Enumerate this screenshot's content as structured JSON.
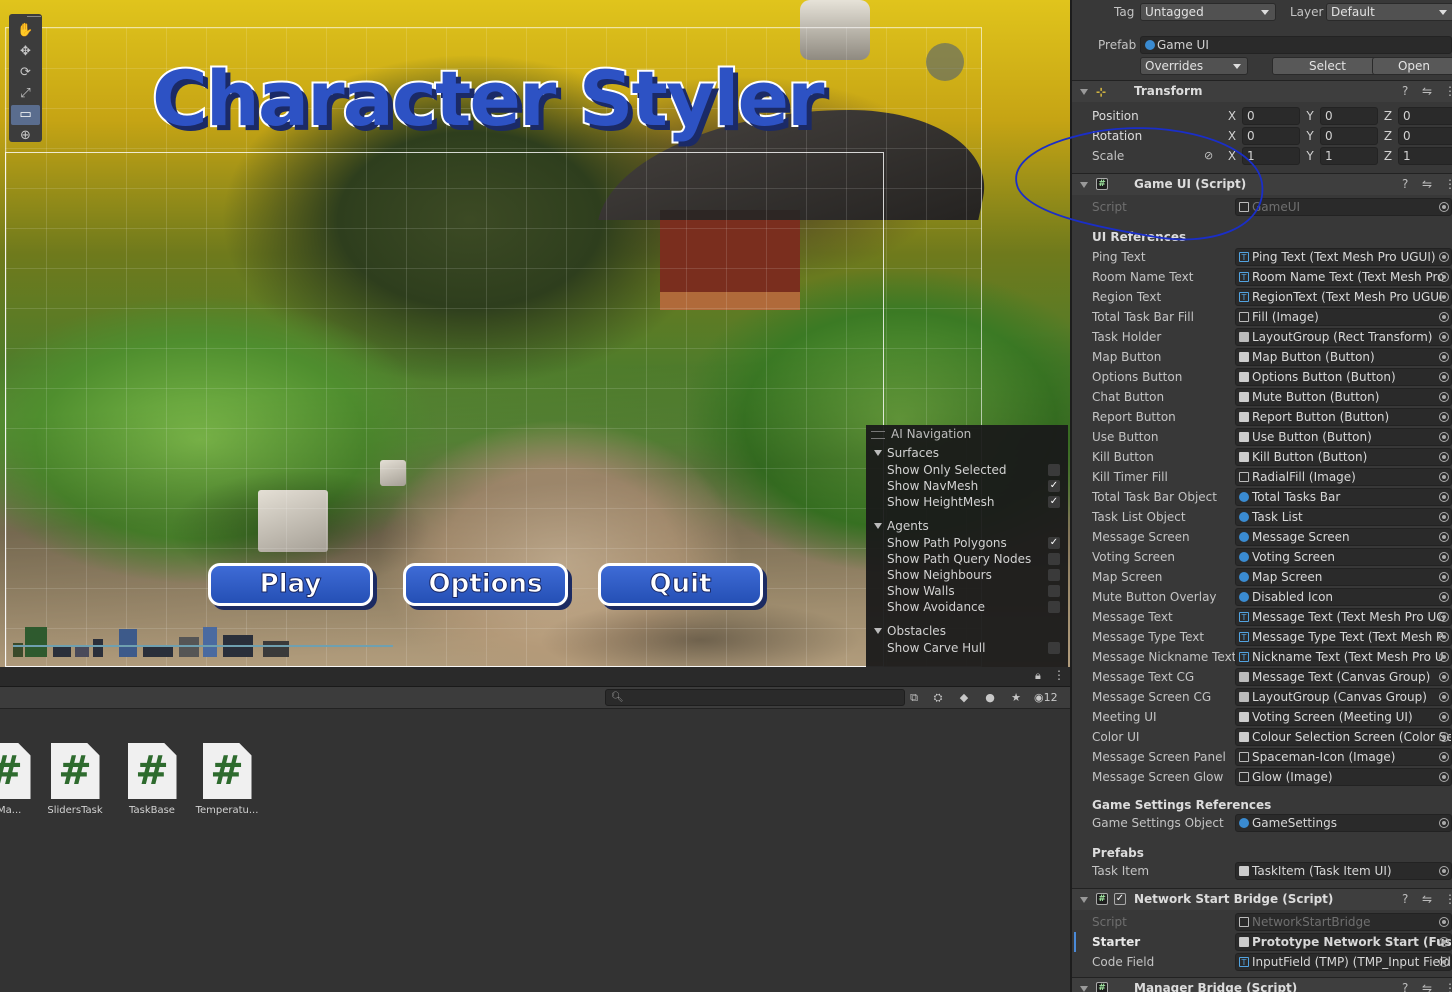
{
  "scene": {
    "title": "Character Styler",
    "buttons": [
      "Play",
      "Options",
      "Quit"
    ],
    "tools": [
      "hand-tool",
      "move-tool",
      "rotate-tool",
      "scale-tool",
      "rect-tool",
      "transform-tool"
    ]
  },
  "ai_nav": {
    "header": "AI Navigation",
    "surfaces_label": "Surfaces",
    "surfaces": [
      {
        "label": "Show Only Selected",
        "checked": false
      },
      {
        "label": "Show NavMesh",
        "checked": true
      },
      {
        "label": "Show HeightMesh",
        "checked": true
      }
    ],
    "agents_label": "Agents",
    "agents": [
      {
        "label": "Show Path Polygons",
        "checked": true
      },
      {
        "label": "Show Path Query Nodes",
        "checked": false
      },
      {
        "label": "Show Neighbours",
        "checked": false
      },
      {
        "label": "Show Walls",
        "checked": false
      },
      {
        "label": "Show Avoidance",
        "checked": false
      }
    ],
    "obstacles_label": "Obstacles",
    "obstacles": [
      {
        "label": "Show Carve Hull",
        "checked": false
      }
    ]
  },
  "project": {
    "hidden_count": "12",
    "assets": [
      "nMa...",
      "SlidersTask",
      "TaskBase",
      "Temperatu..."
    ]
  },
  "inspector": {
    "tag_label": "Tag",
    "tag_value": "Untagged",
    "layer_label": "Layer",
    "layer_value": "Default",
    "prefab_label": "Prefab",
    "prefab_value": "Game UI",
    "overrides": "Overrides",
    "select": "Select",
    "open": "Open",
    "transform": {
      "title": "Transform",
      "position_label": "Position",
      "rotation_label": "Rotation",
      "scale_label": "Scale",
      "position": [
        "0",
        "0",
        "0"
      ],
      "rotation": [
        "0",
        "0",
        "0"
      ],
      "scale": [
        "1",
        "1",
        "1"
      ]
    },
    "game_ui": {
      "title": "Game UI (Script)",
      "script_label": "Script",
      "script_value": "GameUI",
      "ui_refs_header": "UI References",
      "refs": [
        {
          "label": "Ping Text",
          "value": "Ping Text (Text Mesh Pro UGUI)",
          "icon": "t"
        },
        {
          "label": "Room Name Text",
          "value": "Room Name Text (Text Mesh Pro",
          "icon": "t"
        },
        {
          "label": "Region Text",
          "value": "RegionText (Text Mesh Pro UGUI",
          "icon": "t"
        },
        {
          "label": "Total Task Bar Fill",
          "value": "Fill (Image)",
          "icon": "i"
        },
        {
          "label": "Task Holder",
          "value": "LayoutGroup (Rect Transform)",
          "icon": "s"
        },
        {
          "label": "Map Button",
          "value": "Map Button (Button)",
          "icon": "g"
        },
        {
          "label": "Options Button",
          "value": "Options Button (Button)",
          "icon": "g"
        },
        {
          "label": "Chat Button",
          "value": "Mute Button (Button)",
          "icon": "g"
        },
        {
          "label": "Report Button",
          "value": "Report Button (Button)",
          "icon": "g"
        },
        {
          "label": "Use Button",
          "value": "Use Button (Button)",
          "icon": "g"
        },
        {
          "label": "Kill Button",
          "value": "Kill Button (Button)",
          "icon": "g"
        },
        {
          "label": "Kill Timer Fill",
          "value": "RadialFill (Image)",
          "icon": "i"
        },
        {
          "label": "Total Task Bar Object",
          "value": "Total Tasks Bar",
          "icon": "c"
        },
        {
          "label": "Task List Object",
          "value": "Task List",
          "icon": "c"
        },
        {
          "label": "Message Screen",
          "value": "Message Screen",
          "icon": "c"
        },
        {
          "label": "Voting Screen",
          "value": "Voting Screen",
          "icon": "c"
        },
        {
          "label": "Map Screen",
          "value": "Map Screen",
          "icon": "c"
        },
        {
          "label": "Mute Button Overlay",
          "value": "Disabled Icon",
          "icon": "c"
        },
        {
          "label": "Message Text",
          "value": "Message Text (Text Mesh Pro UG",
          "icon": "t"
        },
        {
          "label": "Message Type Text",
          "value": "Message Type Text (Text Mesh P",
          "icon": "t"
        },
        {
          "label": "Message Nickname Text",
          "value": "Nickname Text (Text Mesh Pro U",
          "icon": "t"
        },
        {
          "label": "Message Text CG",
          "value": "Message Text (Canvas Group)",
          "icon": "s"
        },
        {
          "label": "Message Screen CG",
          "value": "LayoutGroup (Canvas Group)",
          "icon": "s"
        },
        {
          "label": "Meeting UI",
          "value": "Voting Screen (Meeting UI)",
          "icon": "g"
        },
        {
          "label": "Color UI",
          "value": "Colour Selection Screen (Color Se",
          "icon": "g"
        },
        {
          "label": "Message Screen Panel",
          "value": "Spaceman-Icon (Image)",
          "icon": "i"
        },
        {
          "label": "Message Screen Glow",
          "value": "Glow (Image)",
          "icon": "i"
        }
      ],
      "settings_header": "Game Settings References",
      "settings_label": "Game Settings Object",
      "settings_value": "GameSettings",
      "prefabs_header": "Prefabs",
      "task_item_label": "Task Item",
      "task_item_value": "TaskItem (Task Item UI)"
    },
    "network": {
      "title": "Network Start Bridge (Script)",
      "script_label": "Script",
      "script_value": "NetworkStartBridge",
      "starter_label": "Starter",
      "starter_value": "Prototype Network Start (Fusion",
      "code_label": "Code Field",
      "code_value": "InputField (TMP) (TMP_Input Field"
    },
    "manager_title": "Manager Bridge (Script)"
  }
}
